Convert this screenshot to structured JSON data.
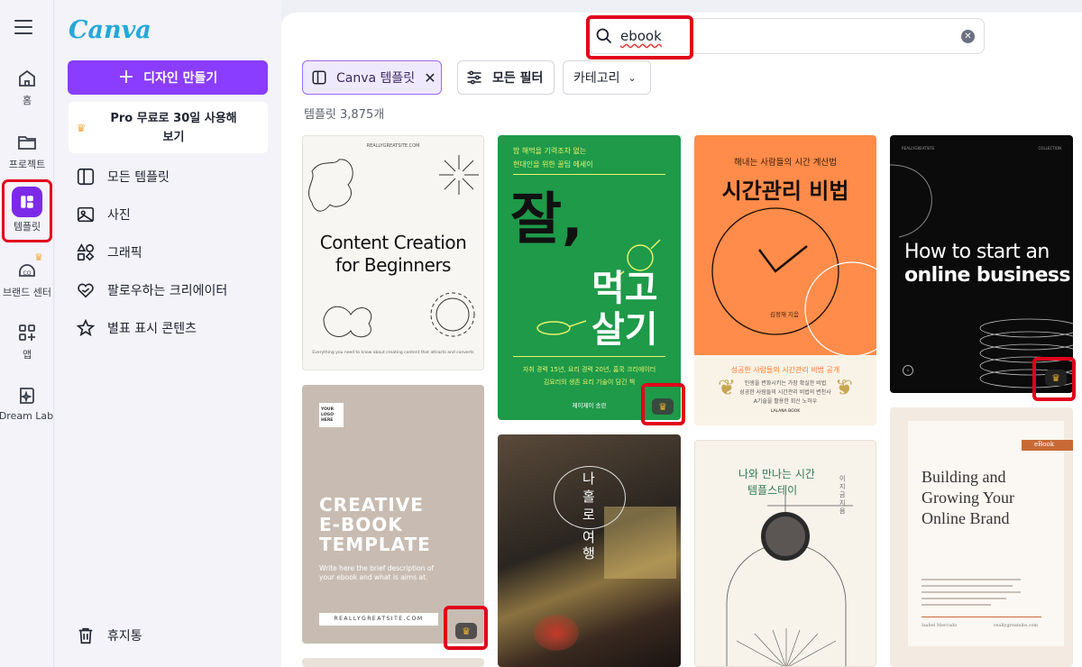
{
  "app": {
    "logo": "Canva"
  },
  "rail": {
    "items": [
      {
        "label": "홈",
        "icon": "home-icon"
      },
      {
        "label": "프로젝트",
        "icon": "folder-icon"
      },
      {
        "label": "템플릿",
        "icon": "templates-icon"
      },
      {
        "label": "브랜드 센터",
        "icon": "brand-icon"
      },
      {
        "label": "앱",
        "icon": "apps-icon"
      },
      {
        "label": "Dream Lab",
        "icon": "dream-lab-icon"
      }
    ]
  },
  "panel": {
    "create_label": "디자인 만들기",
    "pro_label_line1": "Pro 무료로 30일 사용해",
    "pro_label_line2": "보기",
    "nav": [
      {
        "label": "모든 템플릿",
        "icon": "all-templates-icon"
      },
      {
        "label": "사진",
        "icon": "photo-icon"
      },
      {
        "label": "그래픽",
        "icon": "graphics-icon"
      },
      {
        "label": "팔로우하는 크리에이터",
        "icon": "heart-icon"
      },
      {
        "label": "별표 표시 콘텐츠",
        "icon": "star-icon"
      }
    ],
    "trash_label": "휴지통"
  },
  "search": {
    "value": "ebook"
  },
  "filters": {
    "chip_canva": "Canva 템플릿",
    "all_filters": "모든 필터",
    "category": "카테고리"
  },
  "result_count": "템플릿 3,875개",
  "cards": {
    "c1": {
      "site": "REALLYGREATSITE.COM",
      "title1": "Content Creation",
      "title2": "for Beginners",
      "foot": "Everything you need to know about creating content that attracts and converts"
    },
    "c2": {
      "top1": "밥 해먹을 기력조차 없는",
      "top2": "현대인을 위한 꿀팁 에세이",
      "big1": "잘,",
      "big2": "먹고",
      "big3": "살기",
      "desc1": "자취 경력 15년, 요리 경력 20년, 홈쿡 크리에이터",
      "desc2": "김요리의 생존 요리 기술이 담긴 책",
      "author": "제이제이 송란"
    },
    "c3": {
      "top": "해내는 사람들의 시간 계산법",
      "title": "시간관리 비법",
      "author": "김정재 지음",
      "sub": "성공한 사람들의 시간관리 비법 공개",
      "desc1": "인생을 변화시키는 가장 확실한 비법",
      "desc2": "성공한 사람들의 시간관리 비법의 변천사",
      "desc3": "A기술을 활용한 회신 노하우",
      "pub": "LALANA BOOK"
    },
    "c4": {
      "head1": "REALLYGREATSITE",
      "head2": "COLLECTION",
      "title1": "How to start an",
      "title2": "online business"
    },
    "c5": {
      "logo": "YOUR LOGO HERE",
      "title1": "CREATIVE",
      "title2": "E-BOOK",
      "title3": "TEMPLATE",
      "desc": "Write here the brief description of your ebook and what is aims at.",
      "site": "REALLYGREATSITE.COM"
    },
    "c6": {
      "v1": "나",
      "v2": "홀",
      "v3": "로",
      "v4": "여",
      "v5": "행"
    },
    "c7": {
      "title1": "나와 만나는 시간",
      "title2": "템플스테이",
      "author": "이지금 지음"
    },
    "c8": {
      "tag": "eBook",
      "title1": "Building and",
      "title2": "Growing Your",
      "title3": "Online Brand",
      "left": "Isabel Mercado",
      "right": "reallygreatsite.com"
    }
  },
  "colors": {
    "accent": "#8b3dff",
    "highlight": "#e0001b",
    "green": "#1f9a46",
    "orange": "#ff8c4a"
  }
}
